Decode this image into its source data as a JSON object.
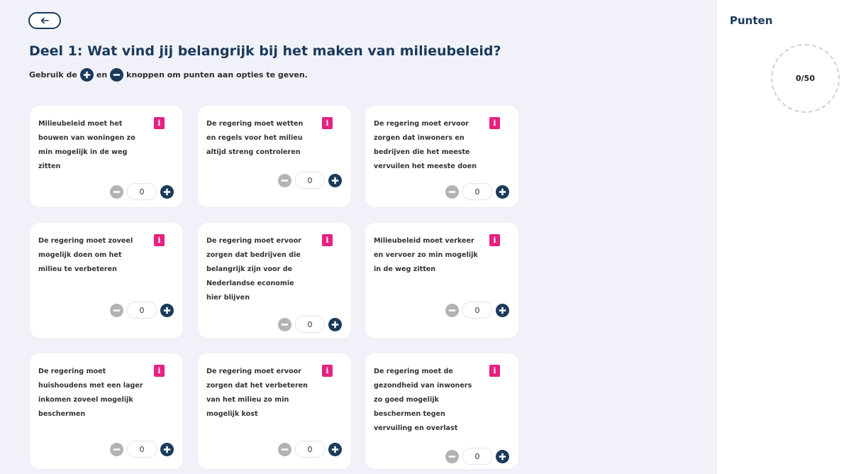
{
  "header": {
    "back_icon": "arrow-left-icon",
    "title": "Deel 1: Wat vind jij belangrijk bij het maken van milieubeleid?",
    "instructions": {
      "prefix": "Gebruik de",
      "middle": "en",
      "suffix": "knoppen om punten aan opties te geven.",
      "plus_icon": "plus-circle-icon",
      "minus_icon": "minus-circle-icon"
    }
  },
  "colors": {
    "primary": "#1a3a5c",
    "accent_pink": "#e6217f",
    "disabled_gray": "#b3b3b3",
    "background": "#f1f2f9"
  },
  "options": [
    {
      "text": "Milieubeleid moet het bouwen van woningen zo min mogelijk in de weg zitten",
      "value": "0",
      "info_label": "i"
    },
    {
      "text": "De regering moet wetten en regels voor het milieu altijd streng controleren",
      "value": "0",
      "info_label": "i"
    },
    {
      "text": "De regering moet ervoor zorgen dat inwoners en bedrijven die het meeste vervuilen het meeste doen",
      "value": "0",
      "info_label": "i"
    },
    {
      "text": "De regering moet zoveel mogelijk doen om het milieu te verbeteren",
      "value": "0",
      "info_label": "i"
    },
    {
      "text": "De regering moet ervoor zorgen dat bedrijven die belangrijk zijn voor de Nederlandse economie hier blijven",
      "value": "0",
      "info_label": "i"
    },
    {
      "text": "Milieubeleid moet verkeer en vervoer zo min mogelijk in de weg zitten",
      "value": "0",
      "info_label": "i"
    },
    {
      "text": "De regering moet huishoudens met een lager inkomen zoveel mogelijk beschermen",
      "value": "0",
      "info_label": "i"
    },
    {
      "text": "De regering moet ervoor zorgen dat het verbeteren van het milieu zo min mogelijk kost",
      "value": "0",
      "info_label": "i"
    },
    {
      "text": "De regering moet de gezondheid van inwoners zo goed mogelijk beschermen tegen vervuiling en overlast",
      "value": "0",
      "info_label": "i"
    }
  ],
  "sidebar": {
    "title": "Punten",
    "points_display": "0/50",
    "points_used": 0,
    "points_total": 50
  }
}
